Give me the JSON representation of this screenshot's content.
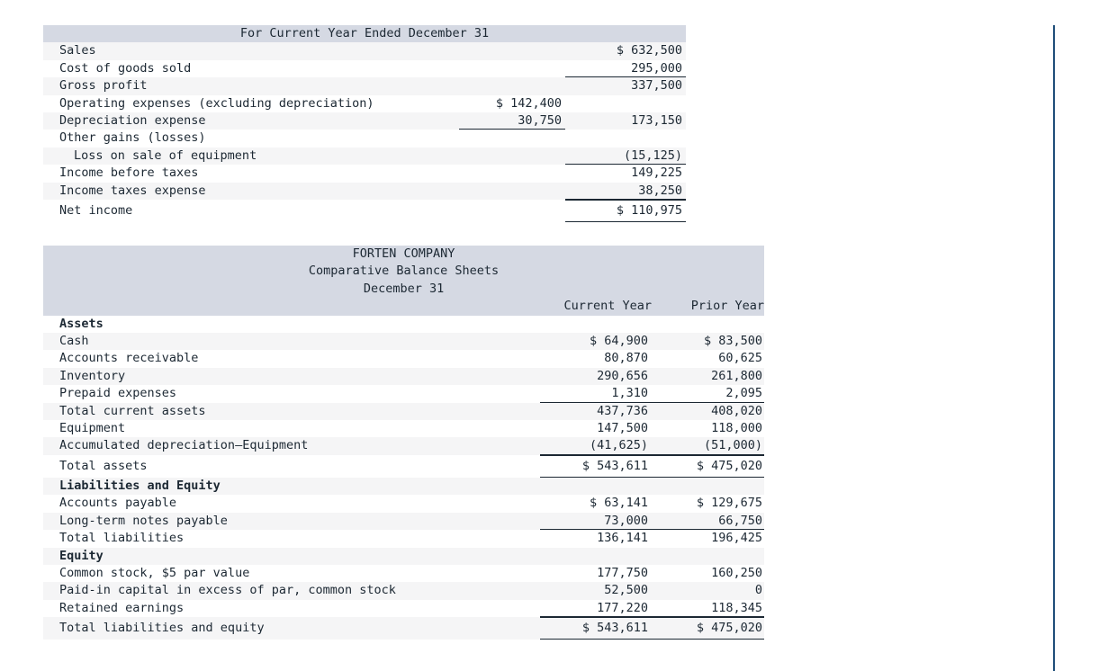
{
  "income_statement": {
    "title": "For Current Year Ended December 31",
    "rows": [
      {
        "label": "Sales",
        "indent": 0,
        "bold": false,
        "col_a": "",
        "col_b": "$ 632,500",
        "rule_b": "none",
        "rule_a": "none"
      },
      {
        "label": "Cost of goods sold",
        "indent": 0,
        "bold": false,
        "col_a": "",
        "col_b": "295,000",
        "rule_b": "single",
        "rule_a": "none"
      },
      {
        "label": "Gross profit",
        "indent": 0,
        "bold": false,
        "col_a": "",
        "col_b": "337,500",
        "rule_b": "none",
        "rule_a": "none"
      },
      {
        "label": "Operating expenses (excluding depreciation)",
        "indent": 0,
        "bold": false,
        "col_a": "$ 142,400",
        "col_b": "",
        "rule_b": "none",
        "rule_a": "none"
      },
      {
        "label": "Depreciation expense",
        "indent": 0,
        "bold": false,
        "col_a": "30,750",
        "col_b": "173,150",
        "rule_b": "none",
        "rule_a": "single"
      },
      {
        "label": "Other gains (losses)",
        "indent": 0,
        "bold": false,
        "col_a": "",
        "col_b": "",
        "rule_b": "none",
        "rule_a": "none"
      },
      {
        "label": "Loss on sale of equipment",
        "indent": 1,
        "bold": false,
        "col_a": "",
        "col_b": "(15,125)",
        "rule_b": "single",
        "rule_a": "none"
      },
      {
        "label": "Income before taxes",
        "indent": 0,
        "bold": false,
        "col_a": "",
        "col_b": "149,225",
        "rule_b": "none",
        "rule_a": "none"
      },
      {
        "label": "Income taxes expense",
        "indent": 0,
        "bold": false,
        "col_a": "",
        "col_b": "38,250",
        "rule_b": "single",
        "rule_a": "none"
      },
      {
        "label": "Net income",
        "indent": 0,
        "bold": false,
        "col_a": "",
        "col_b": "$ 110,975",
        "rule_b": "double",
        "rule_a": "none"
      }
    ]
  },
  "balance_sheet": {
    "company": "FORTEN COMPANY",
    "statement": "Comparative Balance Sheets",
    "period": "December 31",
    "col_current": "Current Year",
    "col_prior": "Prior Year",
    "rows": [
      {
        "label": "Assets",
        "indent": 0,
        "bold": true,
        "current": "",
        "prior": "",
        "rule": "none"
      },
      {
        "label": "Cash",
        "indent": 0,
        "bold": false,
        "current": "$ 64,900",
        "prior": "$ 83,500",
        "rule": "none"
      },
      {
        "label": "Accounts receivable",
        "indent": 0,
        "bold": false,
        "current": "80,870",
        "prior": "60,625",
        "rule": "none"
      },
      {
        "label": "Inventory",
        "indent": 0,
        "bold": false,
        "current": "290,656",
        "prior": "261,800",
        "rule": "none"
      },
      {
        "label": "Prepaid expenses",
        "indent": 0,
        "bold": false,
        "current": "1,310",
        "prior": "2,095",
        "rule": "single"
      },
      {
        "label": "Total current assets",
        "indent": 0,
        "bold": false,
        "current": "437,736",
        "prior": "408,020",
        "rule": "none"
      },
      {
        "label": "Equipment",
        "indent": 0,
        "bold": false,
        "current": "147,500",
        "prior": "118,000",
        "rule": "none"
      },
      {
        "label": "Accumulated depreciation—Equipment",
        "indent": 0,
        "bold": false,
        "current": "(41,625)",
        "prior": "(51,000)",
        "rule": "single"
      },
      {
        "label": "Total assets",
        "indent": 0,
        "bold": false,
        "current": "$ 543,611",
        "prior": "$ 475,020",
        "rule": "double"
      },
      {
        "label": "Liabilities and Equity",
        "indent": 0,
        "bold": true,
        "current": "",
        "prior": "",
        "rule": "none"
      },
      {
        "label": "Accounts payable",
        "indent": 0,
        "bold": false,
        "current": "$ 63,141",
        "prior": "$ 129,675",
        "rule": "none"
      },
      {
        "label": "Long-term notes payable",
        "indent": 0,
        "bold": false,
        "current": "73,000",
        "prior": "66,750",
        "rule": "single"
      },
      {
        "label": "Total liabilities",
        "indent": 0,
        "bold": false,
        "current": "136,141",
        "prior": "196,425",
        "rule": "none"
      },
      {
        "label": "Equity",
        "indent": 0,
        "bold": true,
        "current": "",
        "prior": "",
        "rule": "none"
      },
      {
        "label": "Common stock, $5 par value",
        "indent": 0,
        "bold": false,
        "current": "177,750",
        "prior": "160,250",
        "rule": "none"
      },
      {
        "label": "Paid-in capital in excess of par, common stock",
        "indent": 0,
        "bold": false,
        "current": "52,500",
        "prior": "0",
        "rule": "none"
      },
      {
        "label": "Retained earnings",
        "indent": 0,
        "bold": false,
        "current": "177,220",
        "prior": "118,345",
        "rule": "single"
      },
      {
        "label": "Total liabilities and equity",
        "indent": 0,
        "bold": false,
        "current": "$ 543,611",
        "prior": "$ 475,020",
        "rule": "double"
      }
    ]
  },
  "colors": {
    "band": "#d5d9e3",
    "stripe": "#f5f5f6",
    "rule": "#1c2833",
    "vertical_rule": "#1f4e79"
  }
}
